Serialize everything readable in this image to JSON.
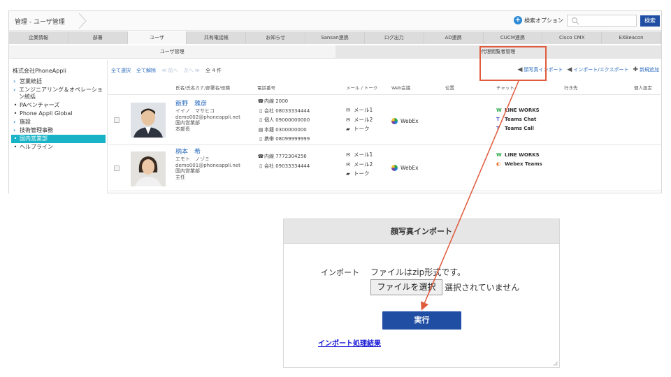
{
  "header": {
    "breadcrumb": "管理 - ユーザ管理",
    "search_option": "検索オプション",
    "search_placeholder": "",
    "search_button": "検索"
  },
  "nav_tabs": [
    "企業情報",
    "部署",
    "ユーザ",
    "共有電話帳",
    "お知らせ",
    "Sansan連携",
    "ログ出力",
    "AD連携",
    "CUCM連携",
    "Cisco CMX",
    "EXBeacon"
  ],
  "sub_tabs": [
    "ユーザ管理",
    "代理閲覧者管理"
  ],
  "sidebar": {
    "company": "株式会社PhoneAppli",
    "items": [
      {
        "label": "営業統括",
        "type": "chevron"
      },
      {
        "label": "エンジニアリング＆オペレーション統括",
        "type": "chevron"
      },
      {
        "label": "PAベンチャーズ",
        "type": "dot"
      },
      {
        "label": "Phone Appli Global",
        "type": "dot"
      },
      {
        "label": "施設",
        "type": "chevron"
      },
      {
        "label": "技術管理事務",
        "type": "chevron"
      },
      {
        "label": "国内営業部",
        "type": "dot",
        "active": true
      },
      {
        "label": "ヘルプライン",
        "type": "dot"
      }
    ]
  },
  "toolbar": {
    "select_all": "全て選択",
    "deselect_all": "全て解除",
    "prev": "≪ 前へ",
    "next": "次へ ≫",
    "count": "全 4 件",
    "photo_import": "顔写真インポート",
    "import_export": "インポート/エクスポート",
    "new_add": "新規追加"
  },
  "columns": [
    "氏名/氏名カナ/部署名/役職",
    "電話番号",
    "メール / トーク",
    "Web会議",
    "位置",
    "チャット",
    "行き先",
    "個人設定"
  ],
  "users": [
    {
      "name": "飯野　雅彦",
      "kana": "イイノ　マサヒコ",
      "email": "demo002@phoneappli.net",
      "dept": "国内営業部",
      "title": "本部長",
      "phones": [
        {
          "icon": "phone-icon",
          "label": "内線 2000"
        },
        {
          "icon": "mobile-icon",
          "label": "会社 08033334444"
        },
        {
          "icon": "mobile-icon",
          "label": "個人 09000000000"
        },
        {
          "icon": "fax-icon",
          "label": "本籍 0300000000"
        },
        {
          "icon": "mobile-icon",
          "label": "携帯 08099999999"
        }
      ],
      "mails": [
        "メール1",
        "メール2",
        "トーク"
      ],
      "webmeeting": "WebEx",
      "chats": [
        {
          "icon": "line-works-icon",
          "label": "LINE WORKS"
        },
        {
          "icon": "teams-icon",
          "label": "Teams Chat"
        },
        {
          "icon": "teams-icon",
          "label": "Teams Call"
        }
      ]
    },
    {
      "name": "柄本　希",
      "kana": "エモト　ノゾミ",
      "email": "demo001@phoneappli.net",
      "dept": "国内営業部",
      "title": "主任",
      "phones": [
        {
          "icon": "phone-icon",
          "label": "内線 7772304256"
        },
        {
          "icon": "mobile-icon",
          "label": "会社 09033334444"
        }
      ],
      "mails": [
        "メール1",
        "メール2",
        "トーク"
      ],
      "webmeeting": "WebEx",
      "chats": [
        {
          "icon": "line-works-icon",
          "label": "LINE WORKS"
        },
        {
          "icon": "webex-teams-icon",
          "label": "Webex Teams"
        }
      ]
    }
  ],
  "dialog": {
    "title": "顔写真インポート",
    "import_label": "インポート",
    "note": "ファイルはzip形式です。",
    "file_button": "ファイルを選択",
    "file_status": "選択されていません",
    "execute": "実行",
    "result_link": "インポート処理結果"
  },
  "colors": {
    "accent_blue": "#1f4ea3",
    "link_blue": "#2c6cbf",
    "active_sidebar": "#18b3c7",
    "annotation_red": "#e05a3c"
  }
}
